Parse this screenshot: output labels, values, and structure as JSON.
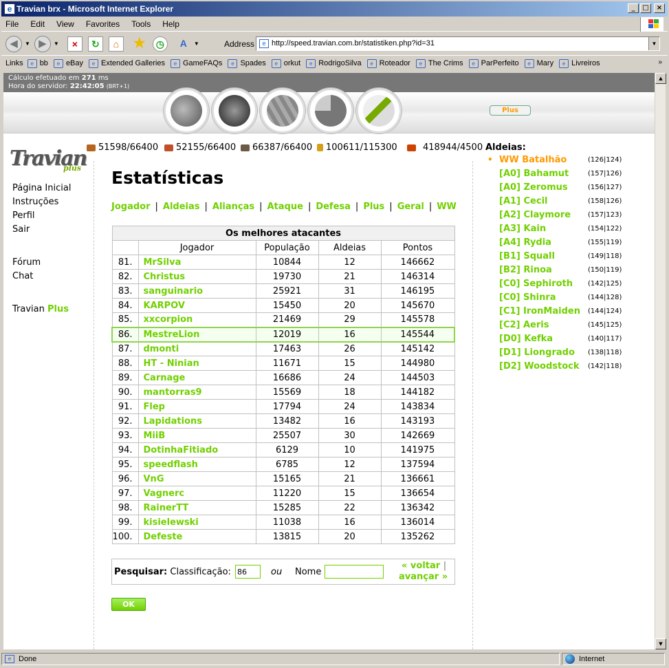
{
  "window": {
    "title": "Travian brx - Microsoft Internet Explorer",
    "menu": [
      "File",
      "Edit",
      "View",
      "Favorites",
      "Tools",
      "Help"
    ],
    "address_label": "Address",
    "url": "http://speed.travian.com.br/statistiken.php?id=31",
    "links_label": "Links",
    "links": [
      "bb",
      "eBay",
      "Extended Galleries",
      "GameFAQs",
      "Spades",
      "orkut",
      "RodrigoSilva",
      "Roteador",
      "The Crims",
      "ParPerfeito",
      "Mary",
      "Livreiros"
    ],
    "status_text": "Done",
    "zone_text": "Internet"
  },
  "server": {
    "calc_prefix": "Cálculo efetuado em",
    "calc_value": "271",
    "calc_unit": "ms",
    "time_prefix": "Hora do servidor:",
    "time_value": "22:42:05",
    "time_zone": "(BRT+1)"
  },
  "plus_button": "Plus",
  "resources": [
    {
      "name": "wood",
      "value": "51598/66400",
      "color": "#b5651d"
    },
    {
      "name": "clay",
      "value": "52155/66400",
      "color": "#c0502a"
    },
    {
      "name": "iron",
      "value": "66387/66400",
      "color": "#6b5a45"
    },
    {
      "name": "crop",
      "value": "100611/115300",
      "color": "#d4a017"
    },
    {
      "name": "consumption",
      "value": "418944/4500",
      "color": "#cc4400"
    }
  ],
  "left_nav": {
    "items": [
      "Página Inicial",
      "Instruções",
      "Perfil",
      "Sair"
    ],
    "items2": [
      "Fórum",
      "Chat"
    ],
    "travian_plus_prefix": "Travian",
    "travian_plus_suffix": "Plus"
  },
  "page_title": "Estatísticas",
  "tabs": [
    "Jogador",
    "Aldeias",
    "Alianças",
    "Ataque",
    "Defesa",
    "Plus",
    "Geral",
    "WW"
  ],
  "table": {
    "caption": "Os melhores atacantes",
    "headers": [
      "",
      "Jogador",
      "População",
      "Aldeias",
      "Pontos"
    ],
    "rows": [
      {
        "rank": "81.",
        "name": "MrSilva",
        "pop": "10844",
        "vil": "12",
        "pts": "146662"
      },
      {
        "rank": "82.",
        "name": "Christus",
        "pop": "19730",
        "vil": "21",
        "pts": "146314"
      },
      {
        "rank": "83.",
        "name": "sanguinario",
        "pop": "25921",
        "vil": "31",
        "pts": "146195"
      },
      {
        "rank": "84.",
        "name": "KARPOV",
        "pop": "15450",
        "vil": "20",
        "pts": "145670"
      },
      {
        "rank": "85.",
        "name": "xxcorpion",
        "pop": "21469",
        "vil": "29",
        "pts": "145578"
      },
      {
        "rank": "86.",
        "name": "MestreLion",
        "pop": "12019",
        "vil": "16",
        "pts": "145544"
      },
      {
        "rank": "87.",
        "name": "dmonti",
        "pop": "17463",
        "vil": "26",
        "pts": "145142"
      },
      {
        "rank": "88.",
        "name": "HT - Ninian",
        "pop": "11671",
        "vil": "15",
        "pts": "144980"
      },
      {
        "rank": "89.",
        "name": "Carnage",
        "pop": "16686",
        "vil": "24",
        "pts": "144503"
      },
      {
        "rank": "90.",
        "name": "mantorras9",
        "pop": "15569",
        "vil": "18",
        "pts": "144182"
      },
      {
        "rank": "91.",
        "name": "Flep",
        "pop": "17794",
        "vil": "24",
        "pts": "143834"
      },
      {
        "rank": "92.",
        "name": "Lapidations",
        "pop": "13482",
        "vil": "16",
        "pts": "143193"
      },
      {
        "rank": "93.",
        "name": "MiiB",
        "pop": "25507",
        "vil": "30",
        "pts": "142669"
      },
      {
        "rank": "94.",
        "name": "DotinhaFitiado",
        "pop": "6129",
        "vil": "10",
        "pts": "141975"
      },
      {
        "rank": "95.",
        "name": "speedflash",
        "pop": "6785",
        "vil": "12",
        "pts": "137594"
      },
      {
        "rank": "96.",
        "name": "VnG",
        "pop": "15165",
        "vil": "21",
        "pts": "136661"
      },
      {
        "rank": "97.",
        "name": "Vagnerc",
        "pop": "11220",
        "vil": "15",
        "pts": "136654"
      },
      {
        "rank": "98.",
        "name": "RainerTT",
        "pop": "15285",
        "vil": "22",
        "pts": "136342"
      },
      {
        "rank": "99.",
        "name": "kisielewski",
        "pop": "11038",
        "vil": "16",
        "pts": "136014"
      },
      {
        "rank": "100.",
        "name": "Defeste",
        "pop": "13815",
        "vil": "20",
        "pts": "135262"
      }
    ],
    "highlighted_rank": "86."
  },
  "search": {
    "label": "Pesquisar:",
    "rank_label": "Classificação:",
    "rank_value": "86",
    "or": "ou",
    "name_label": "Nome",
    "name_value": "",
    "back": "« voltar",
    "forward": "avançar »",
    "ok": "OK"
  },
  "villages": {
    "header": "Aldeias:",
    "list": [
      {
        "name": "WW Batalhão",
        "coords": "(126|124)",
        "active": true
      },
      {
        "name": "[A0] Bahamut",
        "coords": "(157|126)"
      },
      {
        "name": "[A0] Zeromus",
        "coords": "(156|127)"
      },
      {
        "name": "[A1] Cecil",
        "coords": "(158|126)"
      },
      {
        "name": "[A2] Claymore",
        "coords": "(157|123)"
      },
      {
        "name": "[A3] Kain",
        "coords": "(154|122)"
      },
      {
        "name": "[A4] Rydia",
        "coords": "(155|119)"
      },
      {
        "name": "[B1] Squall",
        "coords": "(149|118)"
      },
      {
        "name": "[B2] Rinoa",
        "coords": "(150|119)"
      },
      {
        "name": "[C0] Sephiroth",
        "coords": "(142|125)"
      },
      {
        "name": "[C0] Shinra",
        "coords": "(144|128)"
      },
      {
        "name": "[C1] IronMaiden",
        "coords": "(144|124)"
      },
      {
        "name": "[C2] Aeris",
        "coords": "(145|125)"
      },
      {
        "name": "[D0] Kefka",
        "coords": "(140|117)"
      },
      {
        "name": "[D1] Liongrado",
        "coords": "(138|118)"
      },
      {
        "name": "[D2] Woodstock",
        "coords": "(142|118)"
      }
    ]
  },
  "colors": {
    "link_green": "#71d000",
    "active_orange": "#ff9900",
    "server_bar": "#777777"
  }
}
